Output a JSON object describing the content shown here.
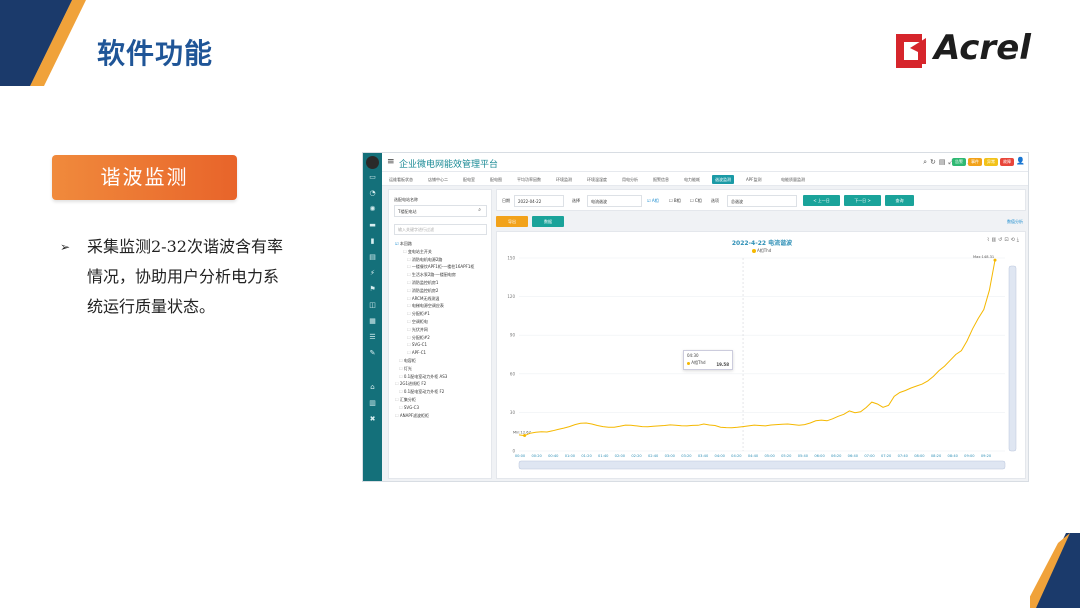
{
  "slide": {
    "title": "软件功能",
    "logo_text": "Acrel",
    "badge": "谐波监测",
    "bullet_lines": [
      "采集监测2-32次谐波含有率",
      "情况，协助用户分析电力系",
      "统运行质量状态。"
    ],
    "colors": {
      "title": "#1f5597",
      "orange": "#e8642a",
      "navy": "#1b3a6b",
      "teal": "#14707a",
      "logo_red": "#d6252b"
    }
  },
  "app": {
    "title": "企业微电网能效管理平台",
    "menu_icon": "menu-icon",
    "tool_icons": [
      "search-icon",
      "refresh-icon",
      "file-icon",
      "expand-icon",
      "grid-icon",
      "shirt-icon"
    ],
    "alarm_pills": [
      {
        "label": "告警",
        "color": "#2eb872"
      },
      {
        "label": "事件",
        "color": "#f2a21a"
      },
      {
        "label": "异常",
        "color": "#f2c21a"
      },
      {
        "label": "故障",
        "color": "#e8463a"
      }
    ],
    "user_icon": "user-icon",
    "rail_icons": [
      "monitor-icon",
      "chart-icon",
      "gear-icon",
      "folder-icon",
      "bar-icon",
      "doc-icon",
      "lightning-icon",
      "flag-icon",
      "layers-icon",
      "table-icon",
      "list-icon",
      "edit-icon",
      "home-icon",
      "building-icon",
      "tools-icon"
    ]
  },
  "navtabs": [
    "运维看板状态",
    "店铺中心二",
    "配电室",
    "配电图",
    "平均功率因数",
    "环境监测",
    "环境温湿度",
    "用电分析",
    "报警信息",
    "电力能耗",
    "谐波监测",
    "APF监测",
    "电能质量监测"
  ],
  "active_tab_index": 10,
  "tree": {
    "label": "选配电站名称",
    "select_value": "T楼配电站",
    "search_placeholder": "输入关键字进行过滤",
    "items": [
      "本回路",
      "变电站主开关",
      "消防电机电源2路",
      "一楼餐饮APF1柜-一楼柱16APF1柜",
      "生活水泵2路-一楼厨电房",
      "消防监控机房1",
      "消防监控机房2",
      "ARCM无线测温",
      "电梯电源空调应表",
      "分配柜#1",
      "空调柜电",
      "光伏并网",
      "分配柜#2",
      "SVG-C1",
      "APF-C1",
      "电容柜",
      "灯光",
      "0.1配电室动力外柜 AS3",
      "2G1进线柜 F2",
      "0.1配电室动力外柜 F2",
      "汇集分柜",
      "SVG-C3",
      "ANAPF滤波柜柜"
    ]
  },
  "filter": {
    "date_label": "日期",
    "date_value": "2022-04-22",
    "select_label": "选择",
    "select_value": "电流谐波",
    "phase_a": "A相",
    "phase_b": "B相",
    "phase_c": "C相",
    "item_label": "选项",
    "item_value": "总谐波",
    "prev_btn": "< 上一日",
    "next_btn": "下一日 >",
    "query_btn": "查询",
    "export_btn": "导出",
    "data_btn": "数据",
    "extra_link": "数值分析"
  },
  "chart_data": {
    "type": "line",
    "title": "2022-4-22 电流谐波",
    "series": [
      {
        "name": "A相Thd",
        "color": "#f5b800",
        "values": [
          12.5,
          12.0,
          13.8,
          14.5,
          15.0,
          14.8,
          15.7,
          16.8,
          17.8,
          19.0,
          20.5,
          21.5,
          21.8,
          21.0,
          19.8,
          19.0,
          18.5,
          18.5,
          19.2,
          20.1,
          20.0,
          19.5,
          19.0,
          18.8,
          19.2,
          19.5,
          19.8,
          20.3,
          20.0,
          19.6,
          19.5,
          19.9,
          20.0,
          21.0,
          20.2,
          19.8,
          18.5,
          18.2,
          18.0,
          18.4,
          19.0,
          19.5,
          20.1,
          19.8,
          19.5,
          20.2,
          20.5,
          20.8,
          21.0,
          20.5,
          20.0,
          20.5,
          21.8,
          23.5,
          24.0,
          23.5,
          25.0,
          27.0,
          28.5,
          31.2,
          29.8,
          30.5,
          33.8,
          38.0,
          36.5,
          34.0,
          35.5,
          42.5,
          45.5,
          47.0,
          49.0,
          50.5,
          52.0,
          54.5,
          58.0,
          62.5,
          66.0,
          70.5,
          75.0,
          78.0,
          85.5,
          95.0,
          103.0,
          110.0,
          125.0,
          148.31
        ]
      }
    ],
    "x_tick_labels": [
      "00:00",
      "00:20",
      "00:40",
      "01:00",
      "01:20",
      "01:40",
      "02:00",
      "02:20",
      "02:40",
      "03:00",
      "03:20",
      "03:40",
      "04:00",
      "04:20",
      "04:40",
      "05:00",
      "05:20",
      "05:40",
      "06:00",
      "06:20",
      "06:40",
      "07:00",
      "07:20",
      "07:40",
      "08:00",
      "08:20",
      "08:40",
      "09:00",
      "09:20"
    ],
    "y_ticks": [
      0,
      30,
      60,
      90,
      120,
      150
    ],
    "ylim": [
      0,
      150
    ],
    "min_label": "Min:12.67",
    "max_label": "Max:148.31",
    "tooltip": {
      "time": "04:30",
      "series": "A相Thd",
      "value": "19.58"
    },
    "grid": true,
    "legend_position": "top"
  }
}
